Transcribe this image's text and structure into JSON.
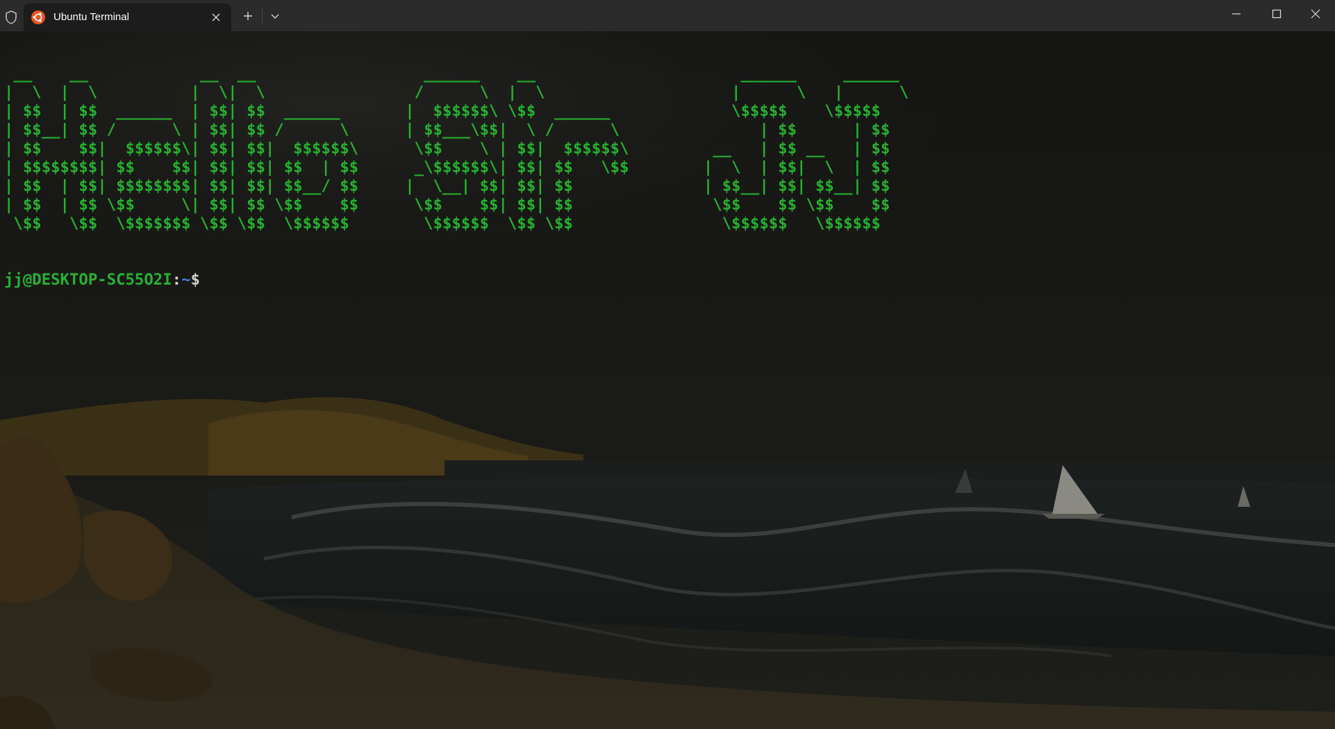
{
  "window": {
    "tab_title": "Ubuntu Terminal",
    "tab_icon": "ubuntu-logo-icon",
    "accent_color": "#e95420"
  },
  "terminal": {
    "banner_lines": [
      " __    __            __  __                  ______    __                      ______     ______ ",
      "|  \\  |  \\          |  \\|  \\                /      \\  |  \\                    |      \\   |      \\",
      "| $$  | $$  ______  | $$| $$  ______       |  $$$$$$\\ \\$$  ______             \\$$$$$    \\$$$$$",
      "| $$__| $$ /      \\ | $$| $$ /      \\      | $$___\\$$|  \\ /      \\               | $$      | $$",
      "| $$    $$|  $$$$$$\\| $$| $$|  $$$$$$\\      \\$$    \\ | $$|  $$$$$$\\         __   | $$ __   | $$",
      "| $$$$$$$$| $$    $$| $$| $$| $$  | $$      _\\$$$$$$\\| $$| $$   \\$$        |  \\  | $$|  \\  | $$",
      "| $$  | $$| $$$$$$$$| $$| $$| $$__/ $$     |  \\__| $$| $$| $$              | $$__| $$| $$__| $$",
      "| $$  | $$ \\$$     \\| $$| $$ \\$$    $$      \\$$    $$| $$| $$               \\$$    $$ \\$$    $$",
      " \\$$   \\$$  \\$$$$$$$ \\$$ \\$$  \\$$$$$$        \\$$$$$$  \\$$ \\$$                \\$$$$$$   \\$$$$$$ "
    ],
    "prompt_user_host": "jj@DESKTOP-SC55O2I",
    "prompt_colon": ":",
    "prompt_path": "~",
    "prompt_symbol": "$",
    "text_color": "#26b22e",
    "path_color": "#4a7dde"
  }
}
